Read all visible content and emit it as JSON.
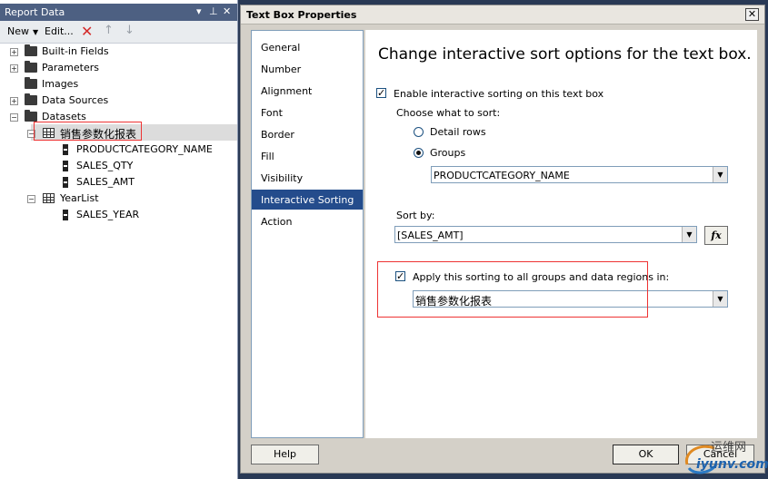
{
  "report_data": {
    "title": "Report Data",
    "toolbar": {
      "new_label": "New",
      "edit_label": "Edit..."
    },
    "tree": [
      {
        "label": "Built-in Fields"
      },
      {
        "label": "Parameters"
      },
      {
        "label": "Images"
      },
      {
        "label": "Data Sources"
      },
      {
        "label": "Datasets"
      },
      {
        "label": "销售参数化报表"
      },
      {
        "label": "PRODUCTCATEGORY_NAME"
      },
      {
        "label": "SALES_QTY"
      },
      {
        "label": "SALES_AMT"
      },
      {
        "label": "YearList"
      },
      {
        "label": "SALES_YEAR"
      }
    ]
  },
  "dialog": {
    "title": "Text Box Properties",
    "nav": [
      "General",
      "Number",
      "Alignment",
      "Font",
      "Border",
      "Fill",
      "Visibility",
      "Interactive Sorting",
      "Action"
    ],
    "active_nav": "Interactive Sorting",
    "heading": "Change interactive sort options for the text box.",
    "enable_label": "Enable interactive sorting on this text box",
    "choose_label": "Choose what to sort:",
    "detail_rows_label": "Detail rows",
    "groups_label": "Groups",
    "groups_value": "PRODUCTCATEGORY_NAME",
    "sort_by_label": "Sort by:",
    "sort_by_value": "[SALES_AMT]",
    "fx_label": "fx",
    "apply_label": "Apply this sorting to all groups and data regions in:",
    "apply_value": "销售参数化报表",
    "help_label": "Help",
    "ok_label": "OK",
    "cancel_label": "Cancel"
  },
  "watermark": {
    "line1": "运维网",
    "line2": "iyunv.com"
  }
}
